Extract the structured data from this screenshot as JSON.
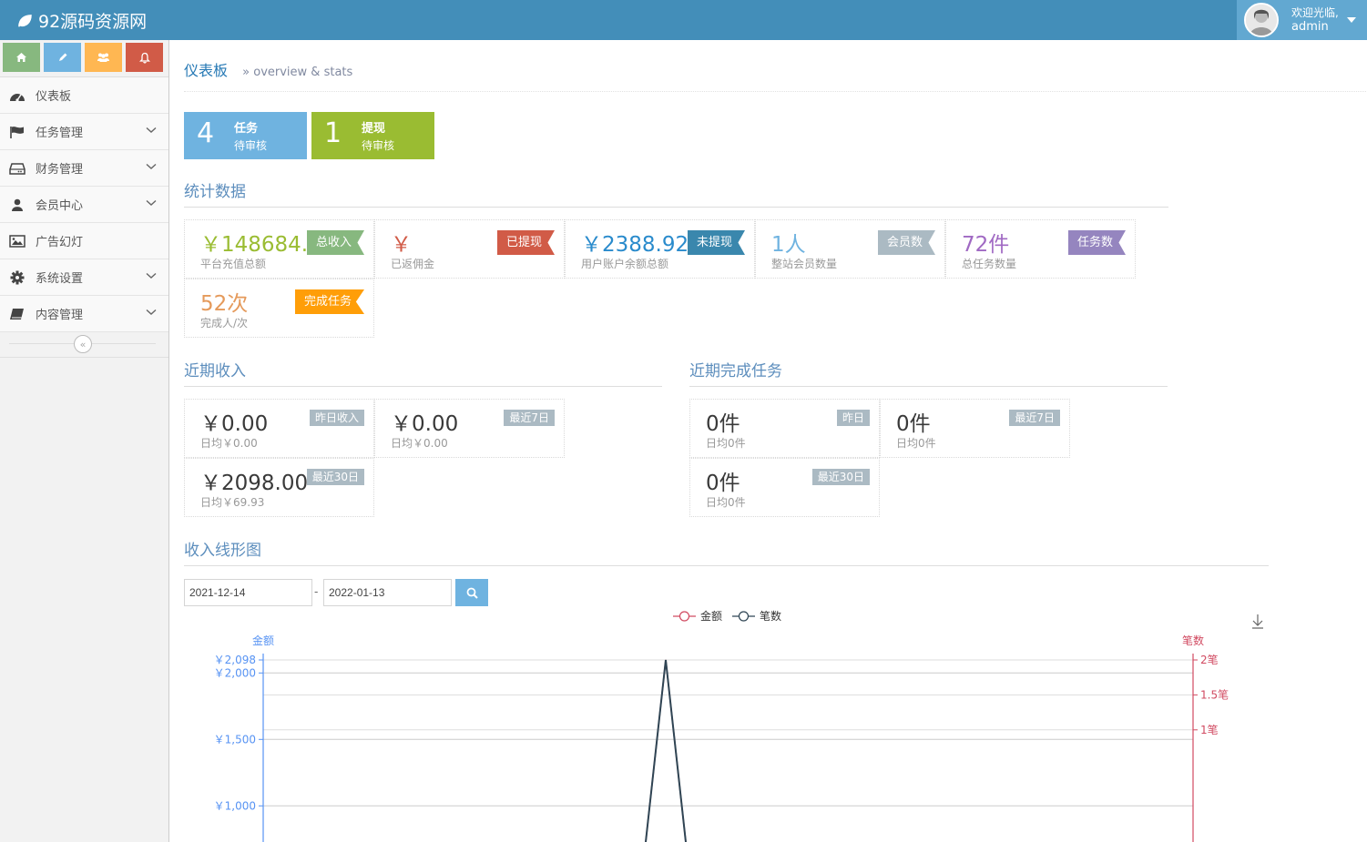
{
  "brand": {
    "title": "92源码资源网"
  },
  "user": {
    "greeting": "欢迎光临,",
    "name": "admin"
  },
  "sidebar": {
    "items": [
      {
        "label": "仪表板"
      },
      {
        "label": "任务管理"
      },
      {
        "label": "财务管理"
      },
      {
        "label": "会员中心"
      },
      {
        "label": "广告幻灯"
      },
      {
        "label": "系统设置"
      },
      {
        "label": "内容管理"
      }
    ],
    "collapse_glyph": "«"
  },
  "page": {
    "title": "仪表板",
    "subtitle": "» overview & stats"
  },
  "pending": [
    {
      "count": "4",
      "line1": "任务",
      "line2": "待审核",
      "color": "#6fb3e0"
    },
    {
      "count": "1",
      "line1": "提现",
      "line2": "待审核",
      "color": "#9abc32"
    }
  ],
  "stats_header": "统计数据",
  "stats": [
    {
      "value": "￥148684.0",
      "label": "平台充值总额",
      "tag": "总收入",
      "value_color": "#9abc32",
      "tag_color": "#87b87f"
    },
    {
      "value": "￥",
      "label": "已返佣金",
      "tag": "已提现",
      "value_color": "#d15b47",
      "tag_color": "#d15b47"
    },
    {
      "value": "￥2388.92",
      "label": "用户账户余额总额",
      "tag": "未提现",
      "value_color": "#2a8bcc",
      "tag_color": "#3a87ad"
    },
    {
      "value": "1人",
      "label": "整站会员数量",
      "tag": "会员数",
      "value_color": "#6fb3e0",
      "tag_color": "#abbac3"
    },
    {
      "value": "72件",
      "label": "总任务数量",
      "tag": "任务数",
      "value_color": "#a069c3",
      "tag_color": "#9585bf"
    },
    {
      "value": "52次",
      "label": "完成人/次",
      "tag": "完成任务",
      "value_color": "#e8b110",
      "tag_color": "#ff9e08"
    }
  ],
  "income_header": "近期收入",
  "income": [
    {
      "value": "￥0.00",
      "label": "日均￥0.00",
      "badge": "昨日收入"
    },
    {
      "value": "￥0.00",
      "label": "日均￥0.00",
      "badge": "最近7日"
    },
    {
      "value": "￥2098.00",
      "label": "日均￥69.93",
      "badge": "最近30日"
    }
  ],
  "tasks_header": "近期完成任务",
  "tasks": [
    {
      "value": "0件",
      "label": "日均0件",
      "badge": "昨日"
    },
    {
      "value": "0件",
      "label": "日均0件",
      "badge": "最近7日"
    },
    {
      "value": "0件",
      "label": "日均0件",
      "badge": "最近30日"
    }
  ],
  "chart_header": "收入线形图",
  "date_range": {
    "start": "2021-12-14",
    "end": "2022-01-13",
    "separator": "-"
  },
  "chart_data": {
    "type": "line",
    "legend": [
      "金额",
      "笔数"
    ],
    "left_axis_title": "金额",
    "right_axis_title": "笔数",
    "left_ticks": [
      "￥2,098",
      "￥2,000",
      "￥1,500",
      "￥1,000"
    ],
    "right_ticks": [
      "2笔",
      "1.5笔",
      "1笔"
    ],
    "ylim_left": [
      0,
      2098
    ],
    "ylim_right": [
      0,
      2
    ],
    "series": [
      {
        "name": "金额",
        "color": "#d14a61",
        "peak": 2098
      },
      {
        "name": "笔数",
        "color": "#2f4554",
        "peak": 2
      }
    ]
  }
}
